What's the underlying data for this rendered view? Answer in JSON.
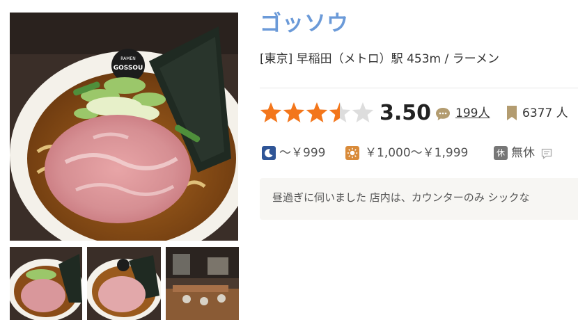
{
  "restaurant": {
    "name": "ゴッソウ",
    "area": "[東京]",
    "station": "早稲田（メトロ）駅",
    "distance": "453m",
    "separator": "/",
    "genre": "ラーメン"
  },
  "rating": {
    "score": "3.50",
    "stars_value": 3.5,
    "stars_max": 5,
    "star_color": "#f3761b",
    "star_empty_color": "#dddddd",
    "review_count": "199人",
    "save_count": "6377",
    "save_unit": "人"
  },
  "price": {
    "dinner_icon": "moon-icon",
    "dinner_price": "～￥999",
    "lunch_icon": "sun-icon",
    "lunch_price": "￥1,000～￥1,999",
    "holiday_icon_label": "休",
    "holiday_text": "無休"
  },
  "review_snippet": "昼過ぎに伺いました 店内は、カウンターのみ シックな",
  "photos": {
    "main_logo_top": "RAMEN",
    "main_logo_main": "GOSSOU"
  },
  "colors": {
    "title": "#6b9ad8",
    "dinner_badge": "#2f5597",
    "lunch_badge": "#d98b3a",
    "holiday_badge": "#777777"
  }
}
